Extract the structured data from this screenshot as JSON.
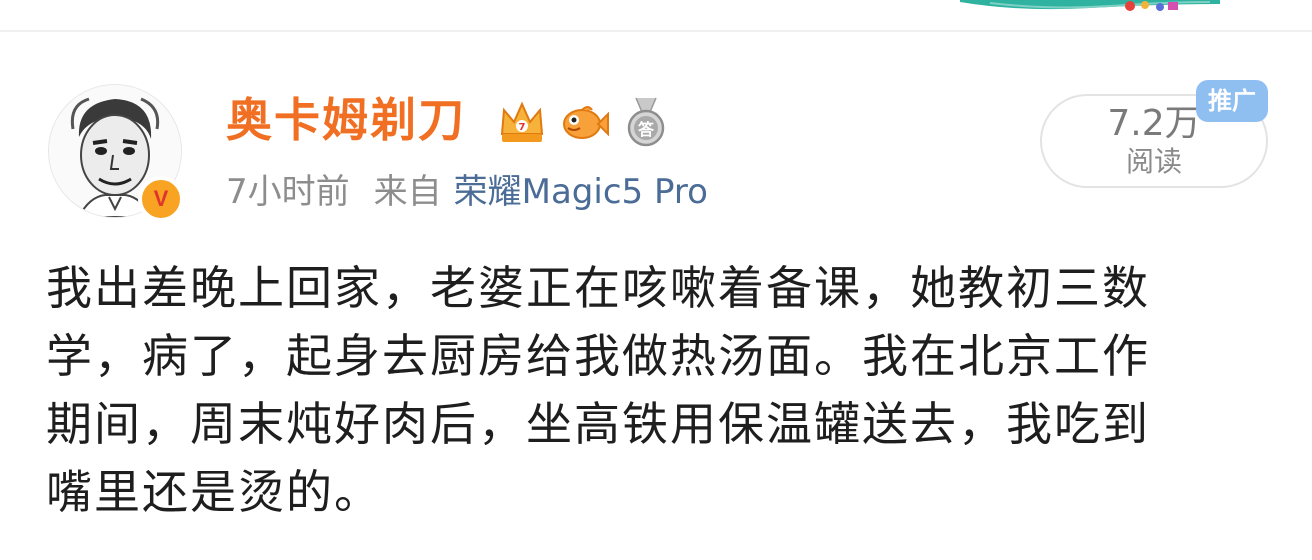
{
  "post": {
    "username": "奥卡姆剃刀",
    "badges": [
      "crown-icon",
      "fish-icon",
      "answer-medal-icon"
    ],
    "medal_char": "答",
    "time": "7小时前",
    "source_label": "来自",
    "device": "荣耀Magic5 Pro",
    "verified_badge": "V",
    "read_count": "7.2万",
    "read_label": "阅读",
    "promo_tag": "推广",
    "text": "我出差晚上回家，老婆正在咳嗽着备课，她教初三数\n学，病了，起身去厨房给我做热汤面。我在北京工作\n期间，周末炖好肉后，坐高铁用保温罐送去，我吃到\n嘴里还是烫的。"
  },
  "colors": {
    "username": "#f16f22",
    "device_link": "#4a6c96",
    "meta": "#8d8d8d",
    "promo_tag": "#8fbef0",
    "verified": "#f8a321"
  }
}
